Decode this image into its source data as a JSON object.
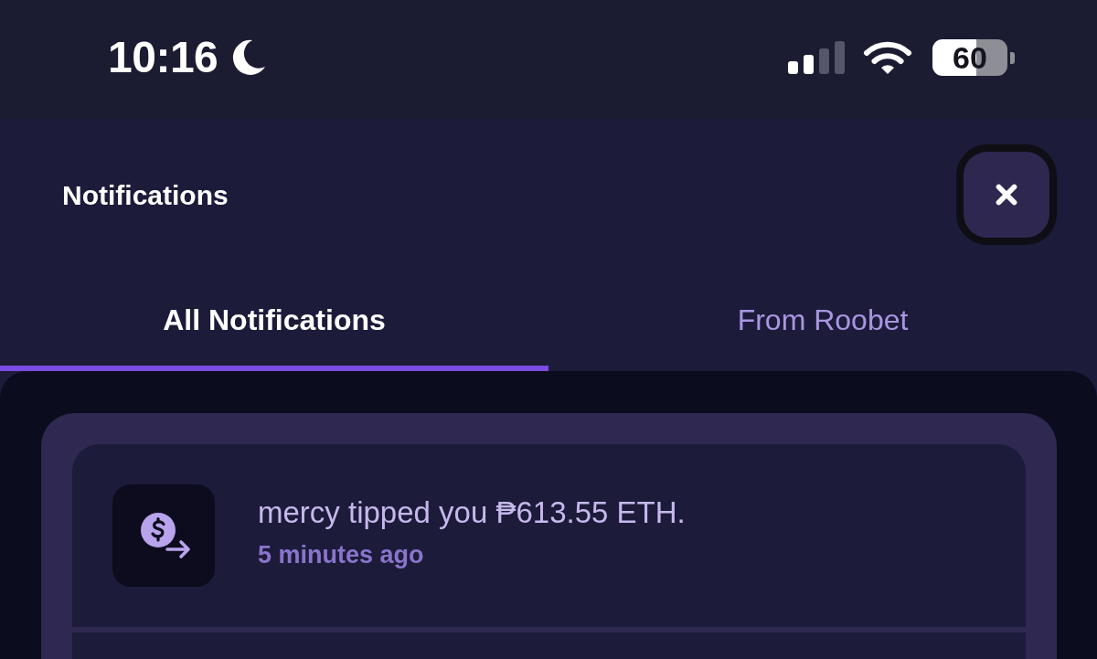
{
  "status_bar": {
    "time": "10:16",
    "battery": "60"
  },
  "header": {
    "title": "Notifications"
  },
  "tabs": [
    {
      "label": "All Notifications",
      "selected": true
    },
    {
      "label": "From Roobet",
      "selected": false
    }
  ],
  "notifications": [
    {
      "message": "mercy tipped you ₱613.55 ETH.",
      "time": "5 minutes ago"
    }
  ]
}
